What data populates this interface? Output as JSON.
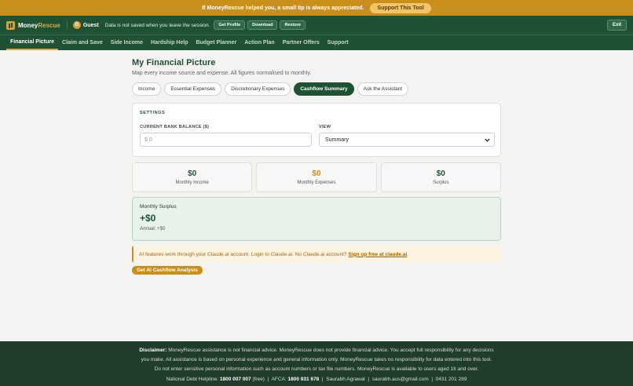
{
  "tipbar": {
    "message": "If MoneyRescue helped you, a small tip is always appreciated.",
    "button": "Support This Tool"
  },
  "header": {
    "brand_part1": "Money",
    "brand_part2": "Rescue",
    "guest_initial": "G",
    "guest_label": "Guest",
    "session_note": "Data is not saved when you leave the session.",
    "buttons": [
      "Get Profile",
      "Download",
      "Restore"
    ],
    "exit": "Exit"
  },
  "nav": [
    "Financial Picture",
    "Claim and Save",
    "Side Income",
    "Hardship Help",
    "Budget Planner",
    "Action Plan",
    "Partner Offers",
    "Support"
  ],
  "main": {
    "title": "My Financial Picture",
    "subtitle": "Map every income source and expense. All figures normalised to monthly.",
    "tabs": [
      "Income",
      "Essential Expenses",
      "Discretionary Expenses",
      "Cashflow Summary",
      "Ask the Assistant"
    ],
    "active_tab": "Cashflow Summary",
    "settings": {
      "title": "SETTINGS",
      "balance_label": "CURRENT BANK BALANCE ($)",
      "balance_placeholder": "$ 0",
      "view_label": "VIEW",
      "view_value": "Summary"
    },
    "stats": [
      {
        "value": "$0",
        "label": "Monthly Income"
      },
      {
        "value": "$0",
        "label": "Monthly Expenses"
      },
      {
        "value": "$0",
        "label": "Surplus"
      }
    ],
    "surplus": {
      "title": "Monthly Surplus",
      "value": "+$0",
      "annual": "Annual: +$0"
    },
    "ai_note": {
      "text": "AI features work through your Claude.ai account. Login to Claude.ai. No Claude.ai account?",
      "link": "Sign up free at claude.ai",
      "suffix": "."
    },
    "ai_button": "Get AI Cashflow Analysis"
  },
  "footer": {
    "disclaimer_label": "Disclaimer:",
    "line1": "MoneyRescue assistance is not financial advice. MoneyRescue does not provide financial advice. You accept full responsibility for any decisions",
    "line2": "you make. All assistance is based on personal experience and general information only. MoneyRescue takes no responsibility for data entered into this tool.",
    "line3": "Do not enter sensitive personal information such as account numbers or tax file numbers. MoneyRescue is available to users aged 16 and over.",
    "helpline_label": "National Debt Helpline:",
    "helpline_number": "1800 007 007",
    "helpline_note": "(free)",
    "afca_label": "AFCA:",
    "afca_number": "1800 931 678",
    "name": "Saurabh Agrawal",
    "email": "saurabh.aus@gmail.com",
    "phone": "0431 201 269",
    "separator": "|"
  },
  "colors": {
    "brand_green": "#1f5233",
    "accent_amber": "#c98f1a",
    "surplus_bg": "#e6f2ea"
  },
  "icons": {
    "logo": "bar-chart-icon",
    "view_select": "chevron-down-icon"
  }
}
